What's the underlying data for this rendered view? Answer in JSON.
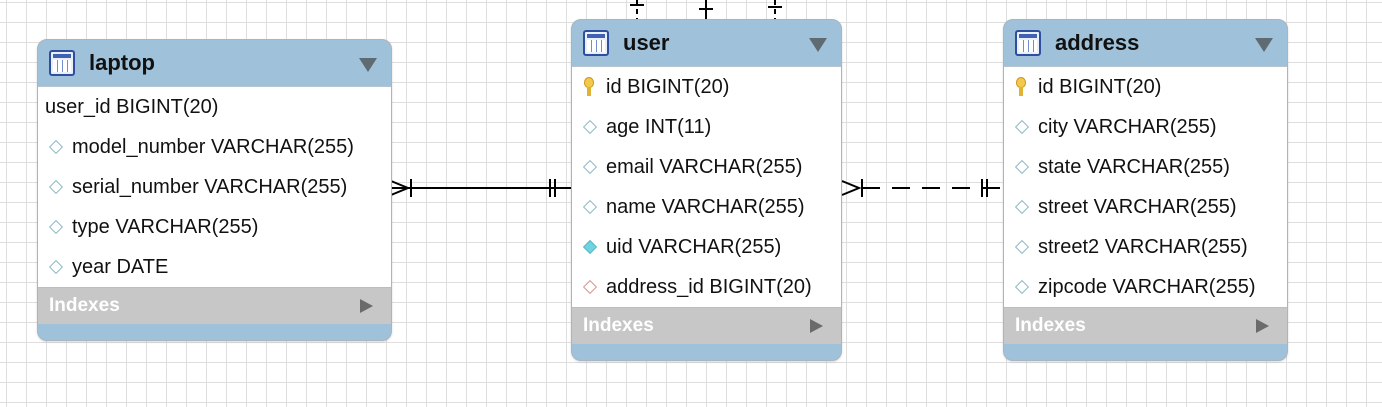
{
  "entities": {
    "laptop": {
      "title": "laptop",
      "fields": [
        {
          "icon": "none",
          "text": "user_id BIGINT(20)"
        },
        {
          "icon": "diamond",
          "text": "model_number VARCHAR(255)"
        },
        {
          "icon": "diamond",
          "text": "serial_number VARCHAR(255)"
        },
        {
          "icon": "diamond",
          "text": "type VARCHAR(255)"
        },
        {
          "icon": "diamond",
          "text": "year DATE"
        }
      ],
      "indexes_label": "Indexes"
    },
    "user": {
      "title": "user",
      "fields": [
        {
          "icon": "key",
          "text": "id BIGINT(20)"
        },
        {
          "icon": "diamond",
          "text": "age INT(11)"
        },
        {
          "icon": "diamond",
          "text": "email VARCHAR(255)"
        },
        {
          "icon": "diamond",
          "text": "name VARCHAR(255)"
        },
        {
          "icon": "diamond-filled",
          "text": "uid VARCHAR(255)"
        },
        {
          "icon": "diamond-fk",
          "text": "address_id BIGINT(20)"
        }
      ],
      "indexes_label": "Indexes"
    },
    "address": {
      "title": "address",
      "fields": [
        {
          "icon": "key",
          "text": "id BIGINT(20)"
        },
        {
          "icon": "diamond",
          "text": "city VARCHAR(255)"
        },
        {
          "icon": "diamond",
          "text": "state VARCHAR(255)"
        },
        {
          "icon": "diamond",
          "text": "street VARCHAR(255)"
        },
        {
          "icon": "diamond",
          "text": "street2 VARCHAR(255)"
        },
        {
          "icon": "diamond",
          "text": "zipcode VARCHAR(255)"
        }
      ],
      "indexes_label": "Indexes"
    }
  },
  "relationships": [
    {
      "from": "laptop",
      "to": "user",
      "style": "solid",
      "from_end": "one-or-many",
      "to_end": "one-and-only-one"
    },
    {
      "from": "user",
      "to": "address",
      "style": "dashed",
      "from_end": "one-or-many",
      "to_end": "one-and-only-one"
    }
  ],
  "colors": {
    "entity_header": "#9fc1d9",
    "indexes_bar": "#c7c7c7",
    "grid": "#dedede",
    "line": "#000000"
  }
}
